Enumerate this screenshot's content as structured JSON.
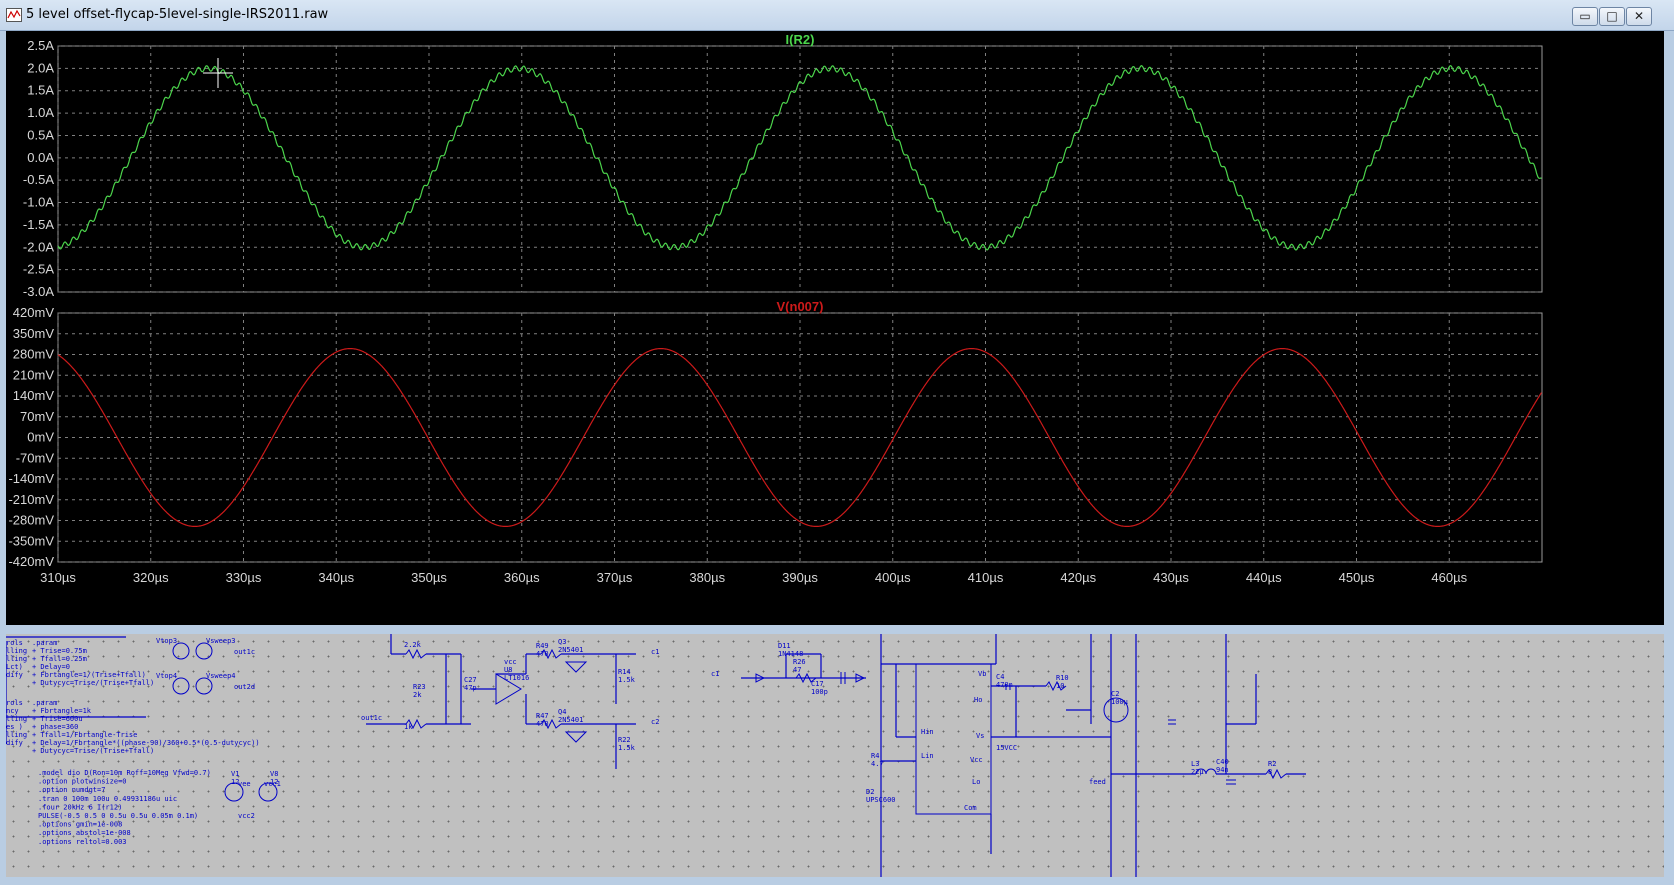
{
  "window": {
    "title": "5 level offset-flycap-5level-single-IRS2011.raw",
    "buttons": {
      "minimize": "▭",
      "maximize": "□",
      "close": "✕"
    }
  },
  "colors": {
    "plot_bg": "#000000",
    "frame": "#9a9a9a",
    "grid": "#808080",
    "trace_current": "#4cd54c",
    "trace_voltage": "#cc1a1a",
    "schematic_bg": "#c0c0c0",
    "schematic_wire": "#0000c8"
  },
  "chart_data": [
    {
      "type": "line",
      "title": "I(R2)",
      "ylim": [
        -3.0,
        2.5
      ],
      "yticks": [
        2.5,
        2.0,
        1.5,
        1.0,
        0.5,
        0.0,
        -0.5,
        -1.0,
        -1.5,
        -2.0,
        -2.5,
        -3.0
      ],
      "ytick_labels": [
        "2.5A",
        "2.0A",
        "1.5A",
        "1.0A",
        "0.5A",
        "0.0A",
        "-0.5A",
        "-1.0A",
        "-1.5A",
        "-2.0A",
        "-2.5A",
        "-3.0A"
      ],
      "xlim_us": [
        310,
        470
      ],
      "amplitude": 2.0,
      "period_us": 33.5,
      "peak_at_us": 326.2,
      "ripple": 0.03,
      "series": [
        {
          "name": "I(R2)",
          "color": "#4cd54c"
        }
      ]
    },
    {
      "type": "line",
      "title": "V(n007)",
      "ylim": [
        -420,
        420
      ],
      "yticks": [
        420,
        350,
        280,
        210,
        140,
        70,
        0,
        -70,
        -140,
        -210,
        -280,
        -350,
        -420
      ],
      "ytick_labels": [
        "420mV",
        "350mV",
        "280mV",
        "210mV",
        "140mV",
        "70mV",
        "0mV",
        "-70mV",
        "-140mV",
        "-210mV",
        "-280mV",
        "-350mV",
        "-420mV"
      ],
      "xlim_us": [
        310,
        470
      ],
      "amplitude": 300,
      "period_us": 33.5,
      "peak_at_us": 341.5,
      "series": [
        {
          "name": "V(n007)",
          "color": "#cc1a1a"
        }
      ]
    }
  ],
  "x_axis": {
    "ticks": [
      310,
      320,
      330,
      340,
      350,
      360,
      370,
      380,
      390,
      400,
      410,
      420,
      430,
      440,
      450,
      460
    ],
    "tick_labels": [
      "310µs",
      "320µs",
      "330µs",
      "340µs",
      "350µs",
      "360µs",
      "370µs",
      "380µs",
      "390µs",
      "400µs",
      "410µs",
      "420µs",
      "430µs",
      "440µs",
      "450µs",
      "460µs"
    ]
  },
  "schematic": {
    "param_block1": [
      ".param",
      "+ Trise=0.75m",
      "+ Tfall=0.25m",
      "+ Delay=0",
      "+ Fbrtangle=1/(Trise+Tfall)",
      "+ Dutycyc=Trise/(Trise+Tfall)"
    ],
    "param_block2": [
      ".param",
      "+ Fbrtangle=1k",
      "+ Trise=600u",
      "+ phase=360",
      "+ Tfall=1/Fbrtangle-Trise",
      "+ Delay=1/Fbrtangle*((phase-90)/360+0.5*(0.5-dutycyc))",
      "+ Dutycyc=Trise/(Trise+Tfall)"
    ],
    "left_margin_labels": [
      "rols",
      "lling",
      "lling",
      "Lct)",
      "dify",
      "rols",
      "ncy",
      "lling",
      "es )",
      "lling",
      "dify"
    ],
    "directives": [
      ".model dio D(Ron=10m Roff=10Meg Vfwd=0.7)",
      ".option plotwinsize=0",
      ".option numdgt=7",
      ".tran 0 100m 100u 0.49931186u uic",
      ".four 20kHz 6 I(r12)",
      "PULSE(-0.5 0.5 0 0.5u 0.5u 0.05m 0.1m)",
      ".options gmin=1e-008",
      ".options abstol=1e-008",
      ".options reltol=0.003"
    ],
    "sweep_labels": [
      "Vtop3",
      "Vsweep3",
      "Vtop4",
      "Vsweep4"
    ],
    "net_labels": [
      "out1c",
      "out2d",
      "out1c",
      "c1",
      "c2",
      "c1",
      "feed"
    ],
    "parts": [
      {
        "ref": "R23",
        "value": "2k"
      },
      {
        "ref": "C27",
        "value": "47p"
      },
      {
        "ref": "U8",
        "value": "LT1016"
      },
      {
        "ref": "R49",
        "value": "470"
      },
      {
        "ref": "R47",
        "value": "470"
      },
      {
        "ref": "Q3",
        "value": "2N5401"
      },
      {
        "ref": "Q4",
        "value": "2N5401"
      },
      {
        "ref": "R14",
        "value": "1.5k"
      },
      {
        "ref": "R22",
        "value": "1.5k"
      },
      {
        "ref": "D11",
        "value": "1N4148"
      },
      {
        "ref": "R26",
        "value": "47"
      },
      {
        "ref": "C17",
        "value": "100p"
      },
      {
        "ref": "R4",
        "value": "4.7"
      },
      {
        "ref": "D2",
        "value": "UPSC600"
      },
      {
        "ref": "C4",
        "value": "470n"
      },
      {
        "ref": "R10",
        "value": "10"
      },
      {
        "ref": "C2",
        "value": "100µ"
      },
      {
        "ref": "L3",
        "value": "22µ"
      },
      {
        "ref": "C40",
        "value": "94n"
      },
      {
        "ref": "R2",
        "value": "8"
      },
      {
        "ref": "V1",
        "value": "12"
      },
      {
        "ref": "V8",
        "value": "12"
      }
    ],
    "misc_labels": [
      "2.2k",
      "1k",
      "vcc",
      "vcc1",
      "vcc2",
      "vee",
      "15VCC"
    ],
    "ic_pins": [
      "Vb",
      "Ho",
      "Hin",
      "Vs",
      "Lin",
      "Vcc",
      "Lo",
      "Com"
    ]
  }
}
